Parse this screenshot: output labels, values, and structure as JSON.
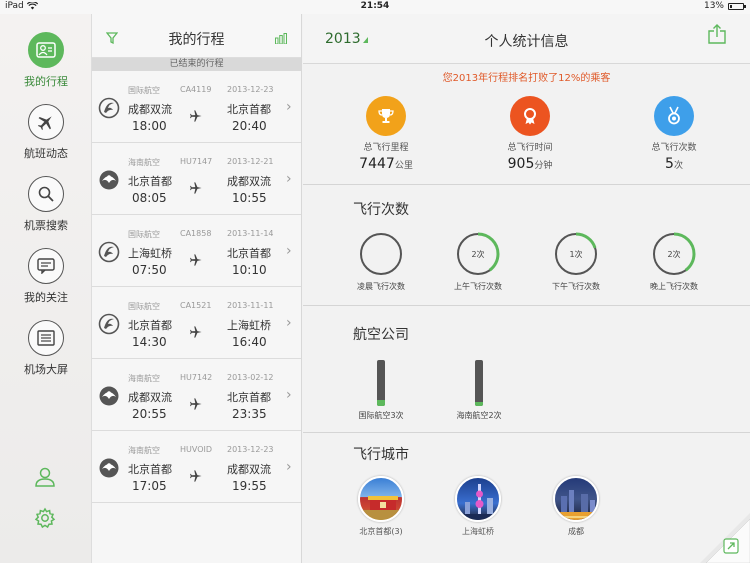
{
  "status_bar": {
    "device": "iPad",
    "time": "21:54",
    "battery": "13%",
    "battery_level": 0.13
  },
  "nav": {
    "items": [
      {
        "label": "我的行程",
        "icon": "user-card-icon",
        "active": true
      },
      {
        "label": "航班动态",
        "icon": "plane-icon",
        "active": false
      },
      {
        "label": "机票搜索",
        "icon": "search-icon",
        "active": false
      },
      {
        "label": "我的关注",
        "icon": "chat-icon",
        "active": false
      },
      {
        "label": "机场大屏",
        "icon": "board-icon",
        "active": false
      }
    ],
    "bottom_icons": [
      "profile-icon",
      "gear-icon"
    ]
  },
  "trips": {
    "title": "我的行程",
    "section": "已结束的行程",
    "list": [
      {
        "airline": "国际航空",
        "flight": "CA4119",
        "date": "2013-12-23",
        "from": "成都双流",
        "to": "北京首都",
        "dep": "18:00",
        "arr": "20:40",
        "logo": "air-china-logo"
      },
      {
        "airline": "海南航空",
        "flight": "HU7147",
        "date": "2013-12-21",
        "from": "北京首都",
        "to": "成都双流",
        "dep": "08:05",
        "arr": "10:55",
        "logo": "hainan-logo"
      },
      {
        "airline": "国际航空",
        "flight": "CA1858",
        "date": "2013-11-14",
        "from": "上海虹桥",
        "to": "北京首都",
        "dep": "07:50",
        "arr": "10:10",
        "logo": "air-china-logo"
      },
      {
        "airline": "国际航空",
        "flight": "CA1521",
        "date": "2013-11-11",
        "from": "北京首都",
        "to": "上海虹桥",
        "dep": "14:30",
        "arr": "16:40",
        "logo": "air-china-logo"
      },
      {
        "airline": "海南航空",
        "flight": "HU7142",
        "date": "2013-02-12",
        "from": "成都双流",
        "to": "北京首都",
        "dep": "20:55",
        "arr": "23:35",
        "logo": "hainan-logo"
      },
      {
        "airline": "海南航空",
        "flight": "HUVOID",
        "date": "2013-12-23",
        "from": "北京首都",
        "to": "成都双流",
        "dep": "17:05",
        "arr": "19:55",
        "logo": "hainan-logo"
      }
    ]
  },
  "stats": {
    "year": "2013",
    "title": "个人统计信息",
    "rank_text": "您2013年行程排名打败了12%的乘客",
    "summary": [
      {
        "label": "总飞行里程",
        "value": "7447",
        "unit": "公里",
        "color": "#f2a21a",
        "icon": "trophy-icon"
      },
      {
        "label": "总飞行时间",
        "value": "905",
        "unit": "分钟",
        "color": "#ec5420",
        "icon": "ribbon-icon"
      },
      {
        "label": "总飞行次数",
        "value": "5",
        "unit": "次",
        "color": "#3e9fea",
        "icon": "medal-icon"
      }
    ],
    "flight_counts": {
      "title": "飞行次数",
      "items": [
        {
          "label": "凌晨飞行次数",
          "count": 0,
          "text": ""
        },
        {
          "label": "上午飞行次数",
          "count": 2,
          "text": "2次"
        },
        {
          "label": "下午飞行次数",
          "count": 1,
          "text": "1次"
        },
        {
          "label": "晚上飞行次数",
          "count": 2,
          "text": "2次"
        }
      ],
      "total": 5
    },
    "airlines": {
      "title": "航空公司",
      "items": [
        {
          "label": "国际航空3次",
          "count": 3
        },
        {
          "label": "海南航空2次",
          "count": 2
        }
      ],
      "total": 5
    },
    "cities": {
      "title": "飞行城市",
      "items": [
        {
          "label": "北京首都(3)",
          "photo": "beijing-photo"
        },
        {
          "label": "上海虹桥",
          "photo": "shanghai-photo"
        },
        {
          "label": "成都",
          "photo": "chengdu-photo"
        }
      ]
    }
  },
  "colors": {
    "accent": "#5db85c",
    "rank": "#e05a2a"
  }
}
